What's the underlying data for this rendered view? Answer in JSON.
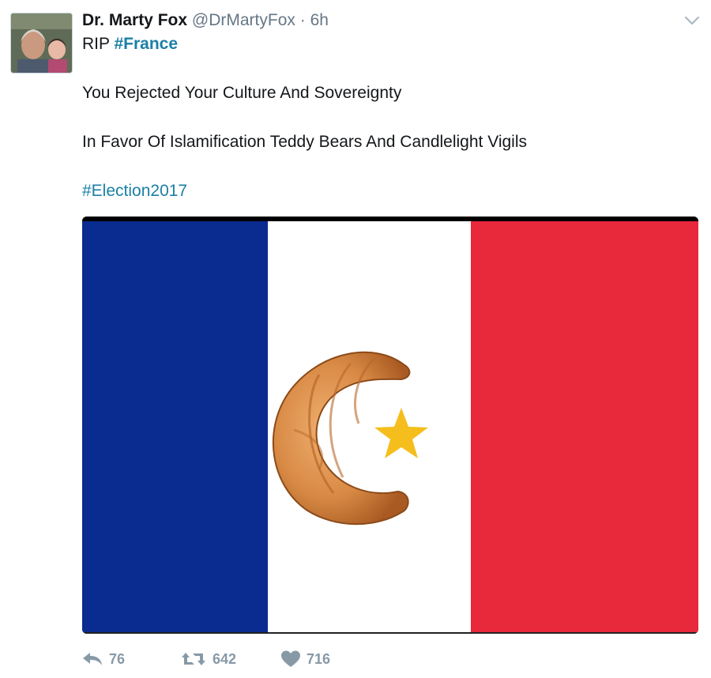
{
  "tweet": {
    "display_name": "Dr. Marty Fox",
    "handle": "@DrMartyFox",
    "separator": "·",
    "time": "6h",
    "line1_prefix": "RIP",
    "line1_hashtag": "#France",
    "line2": "You Rejected Your Culture And Sovereignty",
    "line3": "In Favor Of Islamification Teddy Bears And Candlelight Vigils",
    "line4_hashtag": "#Election2017"
  },
  "media": {
    "flag_colors": {
      "blue": "#0a2b8f",
      "white": "#ffffff",
      "red": "#e8283b",
      "star": "#f5be1c"
    },
    "elements": [
      "croissant",
      "star-icon"
    ]
  },
  "actions": {
    "reply_count": "76",
    "retweet_count": "642",
    "like_count": "716"
  },
  "icons": {
    "caret": "chevron-down-icon",
    "reply": "reply-icon",
    "retweet": "retweet-icon",
    "like": "heart-icon"
  },
  "colors": {
    "link": "#1b7fa6",
    "meta": "#657786",
    "action": "#8899a6"
  }
}
